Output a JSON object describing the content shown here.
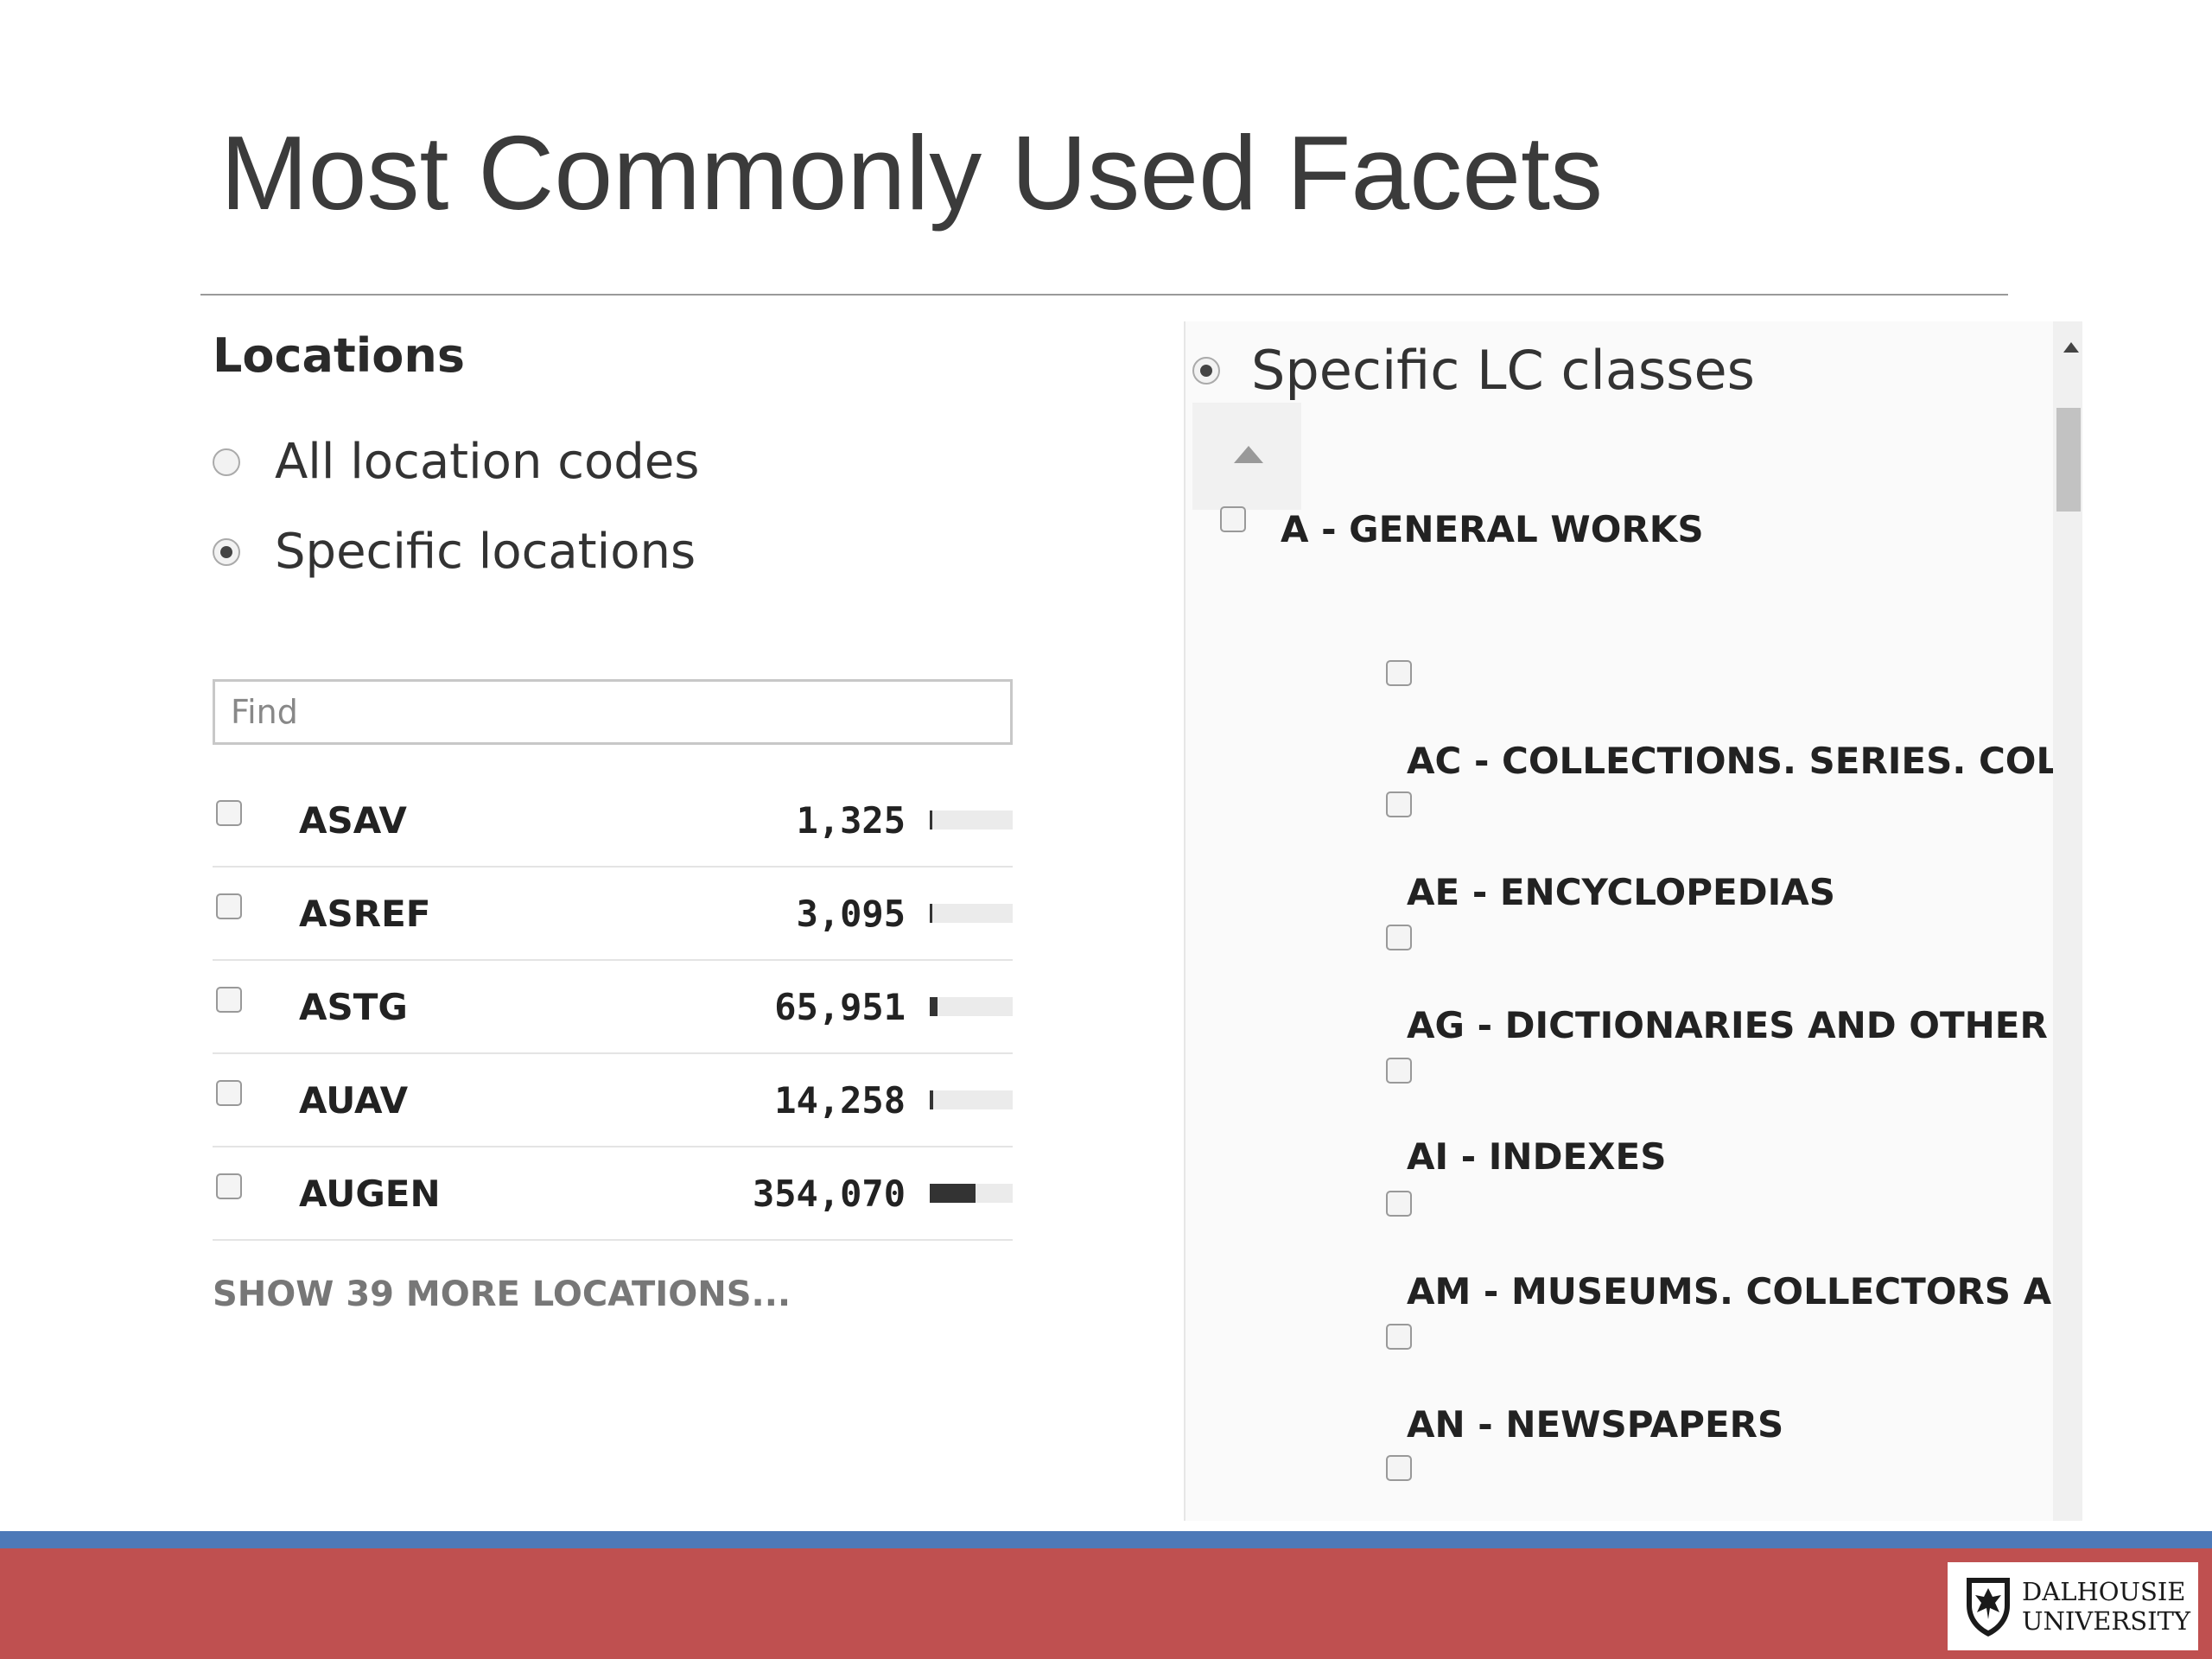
{
  "slide": {
    "title": "Most Commonly Used Facets"
  },
  "locations": {
    "heading": "Locations",
    "options": [
      {
        "label": "All location codes",
        "selected": false
      },
      {
        "label": "Specific locations",
        "selected": true
      }
    ],
    "find_placeholder": "Find",
    "items": [
      {
        "code": "ASAV",
        "count": "1,325",
        "bar_fraction": 0.004
      },
      {
        "code": "ASREF",
        "count": "3,095",
        "bar_fraction": 0.009
      },
      {
        "code": "ASTG",
        "count": "65,951",
        "bar_fraction": 0.09
      },
      {
        "code": "AUAV",
        "count": "14,258",
        "bar_fraction": 0.04
      },
      {
        "code": "AUGEN",
        "count": "354,070",
        "bar_fraction": 0.55
      }
    ],
    "show_more_label": "SHOW 39 MORE LOCATIONS..."
  },
  "lc_classes": {
    "title": "Specific LC classes",
    "top_item": "A - GENERAL WORKS",
    "sub_items": [
      "AC - COLLECTIONS. SERIES. COLL...",
      "AE - ENCYCLOPEDIAS",
      "AG - DICTIONARIES AND OTHER G...",
      "AI - INDEXES",
      "AM - MUSEUMS. COLLECTORS AN...",
      "AN - NEWSPAPERS"
    ]
  },
  "logo": {
    "line1": "DALHOUSIE",
    "line2": "UNIVERSITY"
  },
  "colors": {
    "footer_blue": "#4d79b8",
    "footer_red": "#bf5050"
  }
}
